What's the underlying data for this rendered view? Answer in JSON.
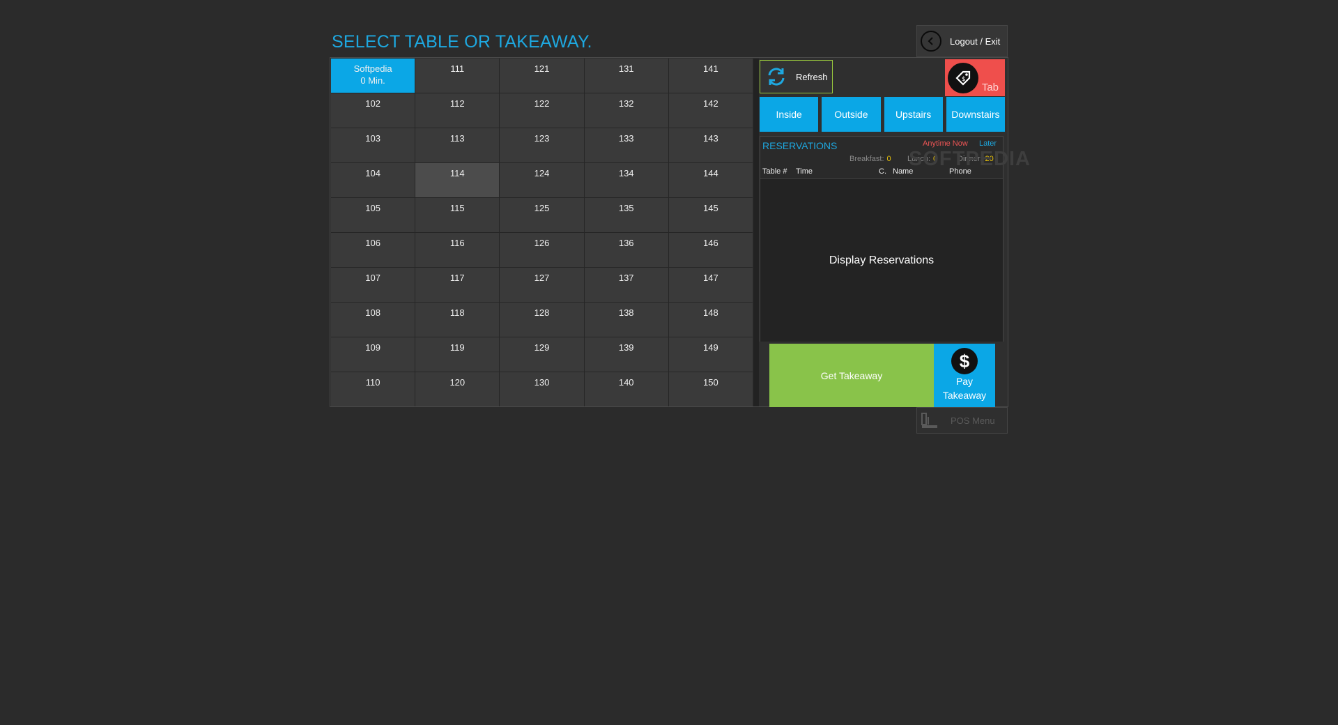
{
  "header": {
    "title": "SELECT TABLE OR TAKEAWAY.",
    "logout_label": "Logout / Exit"
  },
  "tables": {
    "cells": [
      {
        "label": "Softpedia",
        "sub": "0 Min.",
        "state": "active"
      },
      {
        "label": "111"
      },
      {
        "label": "121"
      },
      {
        "label": "131"
      },
      {
        "label": "141"
      },
      {
        "label": "102"
      },
      {
        "label": "112"
      },
      {
        "label": "122"
      },
      {
        "label": "132"
      },
      {
        "label": "142"
      },
      {
        "label": "103"
      },
      {
        "label": "113"
      },
      {
        "label": "123"
      },
      {
        "label": "133"
      },
      {
        "label": "143"
      },
      {
        "label": "104"
      },
      {
        "label": "114",
        "state": "hover"
      },
      {
        "label": "124"
      },
      {
        "label": "134"
      },
      {
        "label": "144"
      },
      {
        "label": "105"
      },
      {
        "label": "115"
      },
      {
        "label": "125"
      },
      {
        "label": "135"
      },
      {
        "label": "145"
      },
      {
        "label": "106"
      },
      {
        "label": "116"
      },
      {
        "label": "126"
      },
      {
        "label": "136"
      },
      {
        "label": "146"
      },
      {
        "label": "107"
      },
      {
        "label": "117"
      },
      {
        "label": "127"
      },
      {
        "label": "137"
      },
      {
        "label": "147"
      },
      {
        "label": "108"
      },
      {
        "label": "118"
      },
      {
        "label": "128"
      },
      {
        "label": "138"
      },
      {
        "label": "148"
      },
      {
        "label": "109"
      },
      {
        "label": "119"
      },
      {
        "label": "129"
      },
      {
        "label": "139"
      },
      {
        "label": "149"
      },
      {
        "label": "110"
      },
      {
        "label": "120"
      },
      {
        "label": "130"
      },
      {
        "label": "140"
      },
      {
        "label": "150"
      }
    ]
  },
  "controls": {
    "refresh_label": "Refresh",
    "refresh_icon": "refresh-icon",
    "tab_label": "Tab",
    "tab_icon": "price-tag-icon",
    "zones": [
      "Inside",
      "Outside",
      "Upstairs",
      "Downstairs"
    ]
  },
  "reservations": {
    "title": "RESERVATIONS",
    "filters": {
      "anytime_now": "Anytime Now",
      "later": "Later"
    },
    "meals": {
      "breakfast_label": "Breakfast:",
      "breakfast_value": "0",
      "lunch_label": "Lunch:",
      "lunch_value": "0",
      "dinner_label": "Dinner:",
      "dinner_value": "20"
    },
    "columns": {
      "table": "Table #",
      "time": "Time",
      "covers": "C.",
      "name": "Name",
      "phone": "Phone"
    },
    "empty_text": "Display Reservations"
  },
  "watermark": "SOFTPEDIA",
  "takeaway": {
    "get_label": "Get Takeaway",
    "pay_icon_glyph": "$",
    "pay_line1": "Pay",
    "pay_line2": "Takeaway"
  },
  "footer": {
    "pos_menu_label": "POS Menu"
  },
  "colors": {
    "accent_blue": "#0ba7e6",
    "title_blue": "#1ea8e0",
    "tab_red": "#ef4f4c",
    "takeaway_green": "#89c34a",
    "meal_yellow": "#e8c20b"
  }
}
